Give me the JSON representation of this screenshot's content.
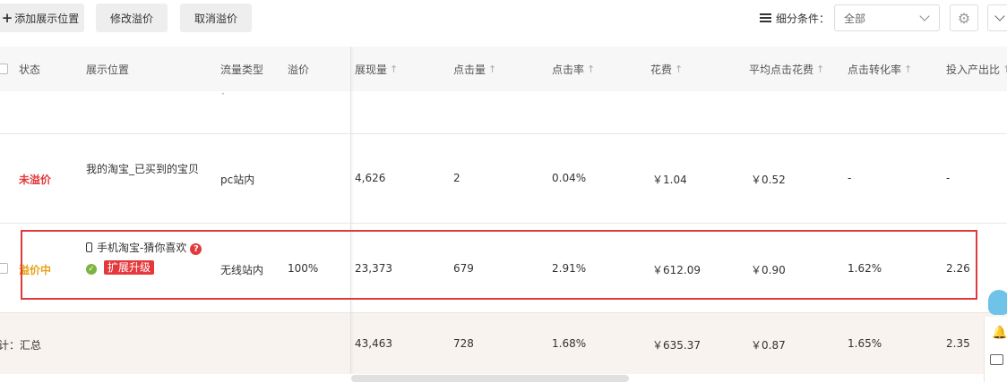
{
  "toolbar": {
    "add_label": "添加展示位置",
    "modify_label": "修改溢价",
    "cancel_label": "取消溢价",
    "filter_label": "细分条件：",
    "filter_value": "全部"
  },
  "table": {
    "headers": {
      "status": "状态",
      "position": "展示位置",
      "traffic": "流量类型",
      "premium": "溢价",
      "impressions": "展现量",
      "clicks": "点击量",
      "ctr": "点击率",
      "cost": "花费",
      "cpc": "平均点击花费",
      "cvr": "点击转化率",
      "roi": "投入产出比"
    },
    "sort_arrow": "↑",
    "partial_row_text": "·",
    "rows": [
      {
        "status": "未溢价",
        "position": "我的淘宝_已买到的宝贝",
        "traffic": "pc站内",
        "premium": "",
        "impressions": "4,626",
        "clicks": "2",
        "ctr": "0.04%",
        "cost": "￥1.04",
        "cpc": "￥0.52",
        "cvr": "-",
        "roi": "-"
      },
      {
        "status": "溢价中",
        "position": "手机淘宝-猜你喜欢",
        "badge": "扩展升级",
        "help": "?",
        "check": "✓",
        "traffic": "无线站内",
        "premium": "100%",
        "impressions": "23,373",
        "clicks": "679",
        "ctr": "2.91%",
        "cost": "￥612.09",
        "cpc": "￥0.90",
        "cvr": "1.62%",
        "roi": "2.26"
      }
    ],
    "total": {
      "label": "计：汇总",
      "impressions": "43,463",
      "clicks": "728",
      "ctr": "1.68%",
      "cost": "￥635.37",
      "cpc": "￥0.87",
      "cvr": "1.65%",
      "roi": "2.35"
    }
  },
  "icons": {
    "gear": "⚙",
    "bell": "🔔"
  },
  "colors": {
    "highlight": "#e03a3a",
    "status_red": "#e4393c",
    "status_orange": "#e8a317",
    "total_bg": "#f8f3ee"
  }
}
